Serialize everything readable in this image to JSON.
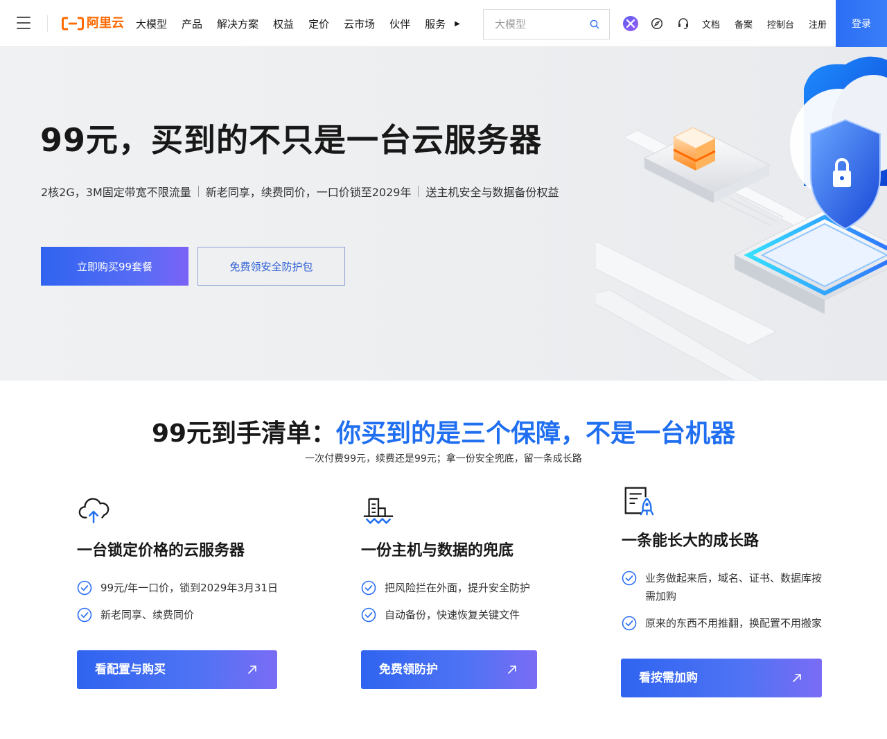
{
  "header": {
    "logo_text": "阿里云",
    "nav": [
      "大模型",
      "产品",
      "解决方案",
      "权益",
      "定价",
      "云市场",
      "伙伴",
      "服务"
    ],
    "search_placeholder": "大模型",
    "links": [
      "文档",
      "备案",
      "控制台",
      "注册"
    ],
    "login_label": "登录",
    "icons": [
      "ai-assistant-icon",
      "compass-icon",
      "headset-icon"
    ]
  },
  "hero": {
    "title": "99元，买到的不只是一台云服务器",
    "subtitle_parts": [
      "2核2G，3M固定带宽不限流量",
      "新老同享，续费同价，一口价锁至2029年",
      "送主机安全与数据备份权益"
    ],
    "primary_button": "立即购买99套餐",
    "secondary_button": "免费领安全防护包"
  },
  "section": {
    "title_black": "99元到手清单：",
    "title_blue": "你买到的是三个保障，不是一台机器",
    "subtitle": "一次付费99元，续费还是99元；拿一份安全兜底，留一条成长路"
  },
  "cards": [
    {
      "icon": "cloud-upload-icon",
      "title": "一台锁定价格的云服务器",
      "items": [
        "99元/年一口价，锁到2029年3月31日",
        "新老同享、续费同价"
      ],
      "button": "看配置与购买"
    },
    {
      "icon": "building-shield-icon",
      "title": "一份主机与数据的兜底",
      "items": [
        "把风险拦在外面，提升安全防护",
        "自动备份，快速恢复关键文件"
      ],
      "button": "免费领防护"
    },
    {
      "icon": "document-rocket-icon",
      "title": "一条能长大的成长路",
      "items": [
        "业务做起来后，域名、证书、数据库按需加购",
        "原来的东西不用推翻，换配置不用搬家"
      ],
      "button": "看按需加购"
    }
  ],
  "colors": {
    "brand_orange": "#ff6a00",
    "accent_blue": "#1f6ff0",
    "button_gradient_start": "#2f64f0",
    "button_gradient_end": "#7a6cf5"
  }
}
